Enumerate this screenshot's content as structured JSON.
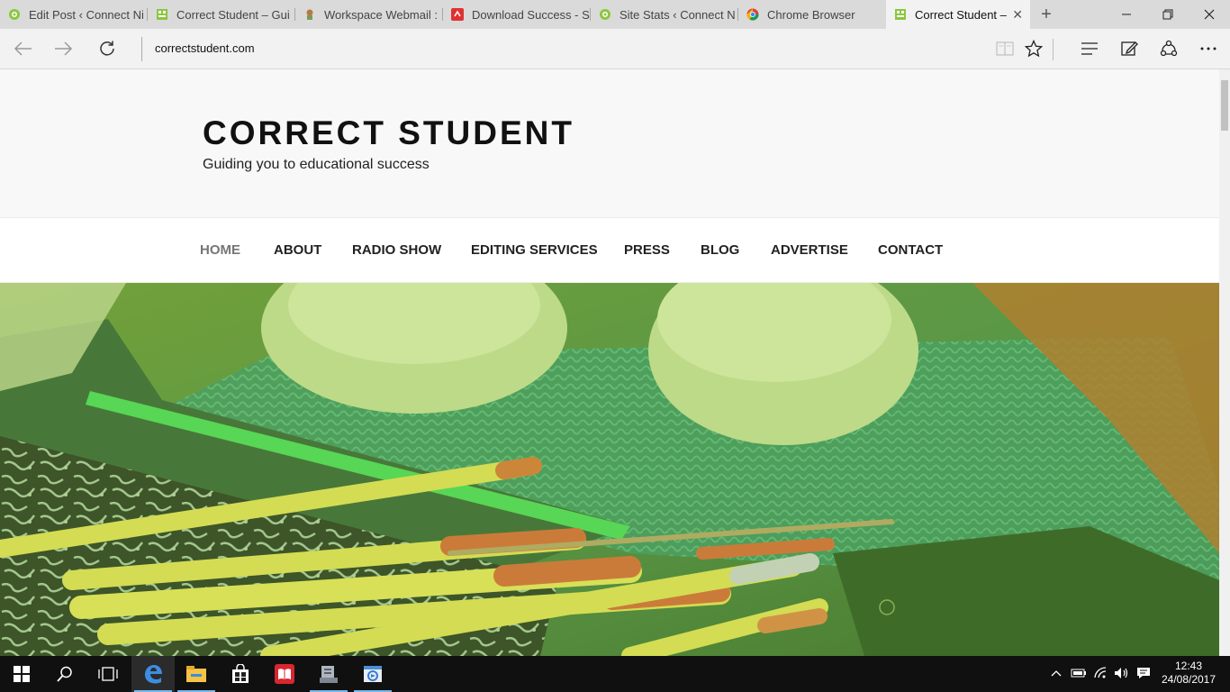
{
  "browser": {
    "tabs": [
      {
        "title": "Edit Post ‹ Connect Ni",
        "favicon": "connect-favicon"
      },
      {
        "title": "Correct Student – Gui",
        "favicon": "correctstudent-favicon"
      },
      {
        "title": "Workspace Webmail :",
        "favicon": "webmail-favicon"
      },
      {
        "title": "Download Success - S",
        "favicon": "download-favicon"
      },
      {
        "title": "Site Stats ‹ Connect N",
        "favicon": "connect-favicon"
      },
      {
        "title": "Chrome Browser",
        "favicon": "chrome-favicon"
      },
      {
        "title": "Correct Student –",
        "favicon": "correctstudent-favicon",
        "active": true
      }
    ],
    "new_tab_symbol": "+",
    "url": "correctstudent.com"
  },
  "site": {
    "title": "CORRECT STUDENT",
    "tagline": "Guiding you to educational success",
    "menu": [
      {
        "label": "HOME",
        "current": true
      },
      {
        "label": "ABOUT"
      },
      {
        "label": "RADIO SHOW"
      },
      {
        "label": "EDITING SERVICES"
      },
      {
        "label": "PRESS"
      },
      {
        "label": "BLOG"
      },
      {
        "label": "ADVERTISE"
      },
      {
        "label": "CONTACT"
      }
    ]
  },
  "taskbar": {
    "time": "12:43",
    "date": "24/08/2017",
    "apps": [
      "edge-icon",
      "file-explorer-icon",
      "store-icon",
      "reader-icon",
      "app-icon",
      "media-icon"
    ]
  },
  "colors": {
    "accent": "#76b9ed",
    "hero_tint": "#8bbf3a",
    "title": "#111111"
  }
}
